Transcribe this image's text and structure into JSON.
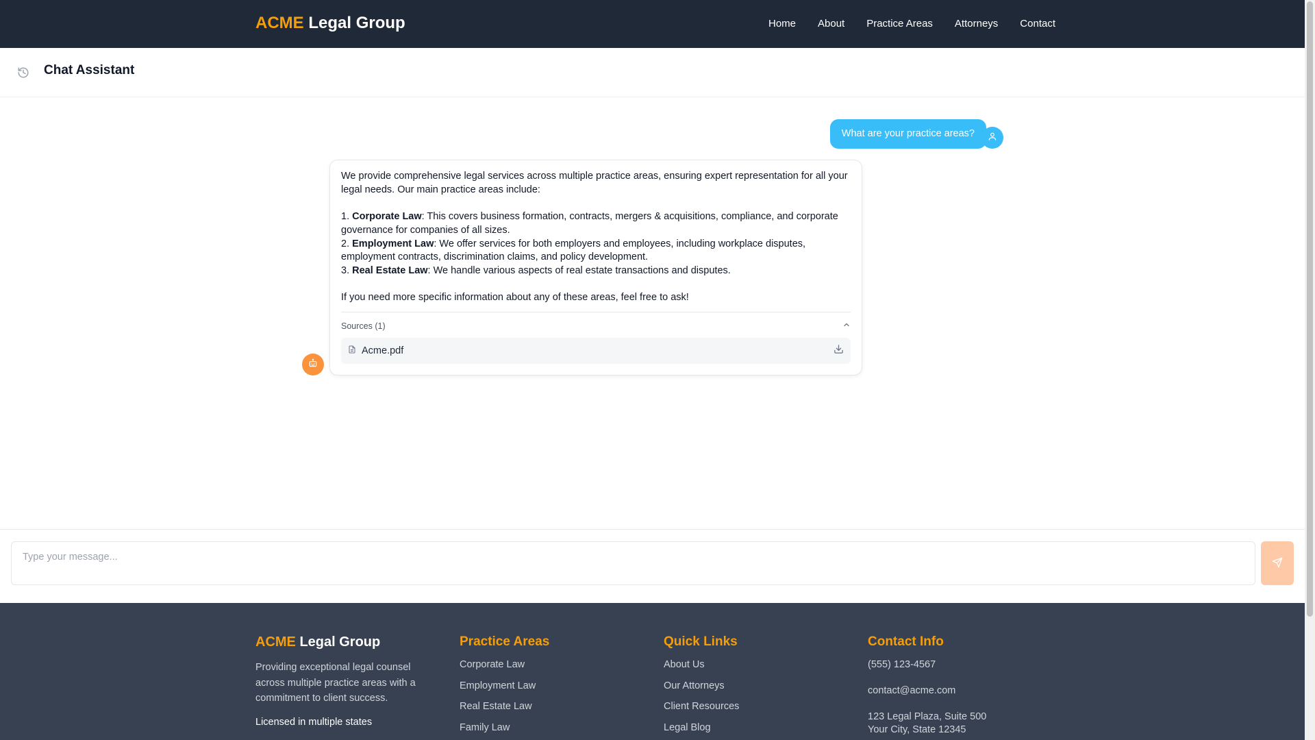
{
  "header": {
    "brand_accent": "ACME",
    "brand_rest": " Legal Group",
    "nav": [
      "Home",
      "About",
      "Practice Areas",
      "Attorneys",
      "Contact"
    ]
  },
  "chat": {
    "title": "Chat Assistant",
    "user_message": "What are your practice areas?",
    "bot": {
      "intro": "We provide comprehensive legal services across multiple practice areas, ensuring expert representation for all your legal needs. Our main practice areas include:",
      "items": [
        {
          "num": "1. ",
          "title": "Corporate Law",
          "text": ": This covers business formation, contracts, mergers & acquisitions, compliance, and corporate governance for companies of all sizes."
        },
        {
          "num": "2. ",
          "title": "Employment Law",
          "text": ": We offer services for both employers and employees, including workplace disputes, employment contracts, discrimination claims, and policy development."
        },
        {
          "num": "3. ",
          "title": "Real Estate Law",
          "text": ": We handle various aspects of real estate transactions and disputes."
        }
      ],
      "outro": "If you need more specific information about any of these areas, feel free to ask!",
      "sources_label": "Sources (1)",
      "sources": [
        "Acme.pdf"
      ]
    },
    "input_placeholder": "Type your message..."
  },
  "footer": {
    "brand_accent": "ACME",
    "brand_rest": " Legal Group",
    "description": "Providing exceptional legal counsel across multiple practice areas with a commitment to client success.",
    "licensed": "Licensed in multiple states",
    "practice_title": "Practice Areas",
    "practice_links": [
      "Corporate Law",
      "Employment Law",
      "Real Estate Law",
      "Family Law"
    ],
    "quick_title": "Quick Links",
    "quick_links": [
      "About Us",
      "Our Attorneys",
      "Client Resources",
      "Legal Blog"
    ],
    "contact_title": "Contact Info",
    "phone": "(555) 123-4567",
    "email": "contact@acme.com",
    "address_line1": "123 Legal Plaza, Suite 500",
    "address_line2": "Your City, State 12345"
  },
  "colors": {
    "nav_bg": "#1f2937",
    "accent": "#f59e0b",
    "user_bubble": "#38bdf8",
    "bot_avatar": "#fb923c",
    "send_button": "#fdc9a7",
    "footer_bg": "#374151"
  },
  "icons": {
    "history": "history-icon",
    "user_avatar": "user-icon",
    "bot_avatar": "bot-icon",
    "file": "file-icon",
    "download": "download-icon",
    "collapse": "chevron-up-icon",
    "send": "send-icon"
  }
}
